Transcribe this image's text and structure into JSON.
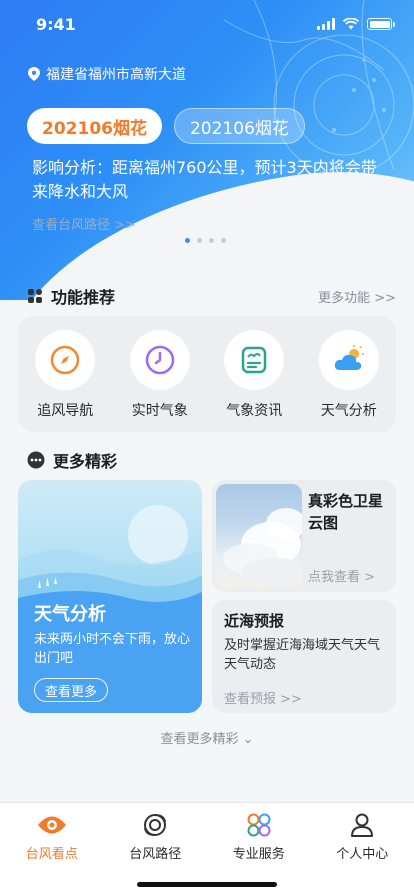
{
  "status_bar": {
    "time": "9:41"
  },
  "header": {
    "location": "福建省福州市高新大道",
    "typhoon_tabs": [
      {
        "label": "202106烟花"
      },
      {
        "label": "202106烟花"
      }
    ],
    "impact_text": "影响分析：距离福州760公里，预计3天内将会带来降水和大风",
    "path_link": "查看台风路径 >>",
    "carousel_index": 1,
    "carousel_count": 4
  },
  "features": {
    "title": "功能推荐",
    "more": "更多功能 >>",
    "items": [
      {
        "label": "追风导航",
        "icon": "compass-icon",
        "color": "#f08a32"
      },
      {
        "label": "实时气象",
        "icon": "clock-icon",
        "color": "#9b6cf0"
      },
      {
        "label": "气象资讯",
        "icon": "news-icon",
        "color": "#2aa58a"
      },
      {
        "label": "天气分析",
        "icon": "weather-icon",
        "color": "#3aa0f5"
      }
    ]
  },
  "more_section": {
    "title": "更多精彩",
    "big_card": {
      "title": "天气分析",
      "desc": "未来两小时不会下雨，放心出门吧",
      "button": "查看更多"
    },
    "satellite_card": {
      "title": "真彩色卫星云图",
      "link": "点我查看 >"
    },
    "sea_card": {
      "title": "近海预报",
      "desc": "及时掌握近海海域天气天气天气动态",
      "link": "查看预报 >>"
    },
    "view_more": "查看更多精彩"
  },
  "tabbar": {
    "items": [
      {
        "label": "台风看点",
        "icon": "eye-icon",
        "active": true
      },
      {
        "label": "台风路径",
        "icon": "typhoon-icon",
        "active": false
      },
      {
        "label": "专业服务",
        "icon": "grid-icon",
        "active": false
      },
      {
        "label": "个人中心",
        "icon": "person-icon",
        "active": false
      }
    ]
  },
  "colors": {
    "accent": "#f27a2a",
    "primary_blue": "#2f7bf5"
  }
}
